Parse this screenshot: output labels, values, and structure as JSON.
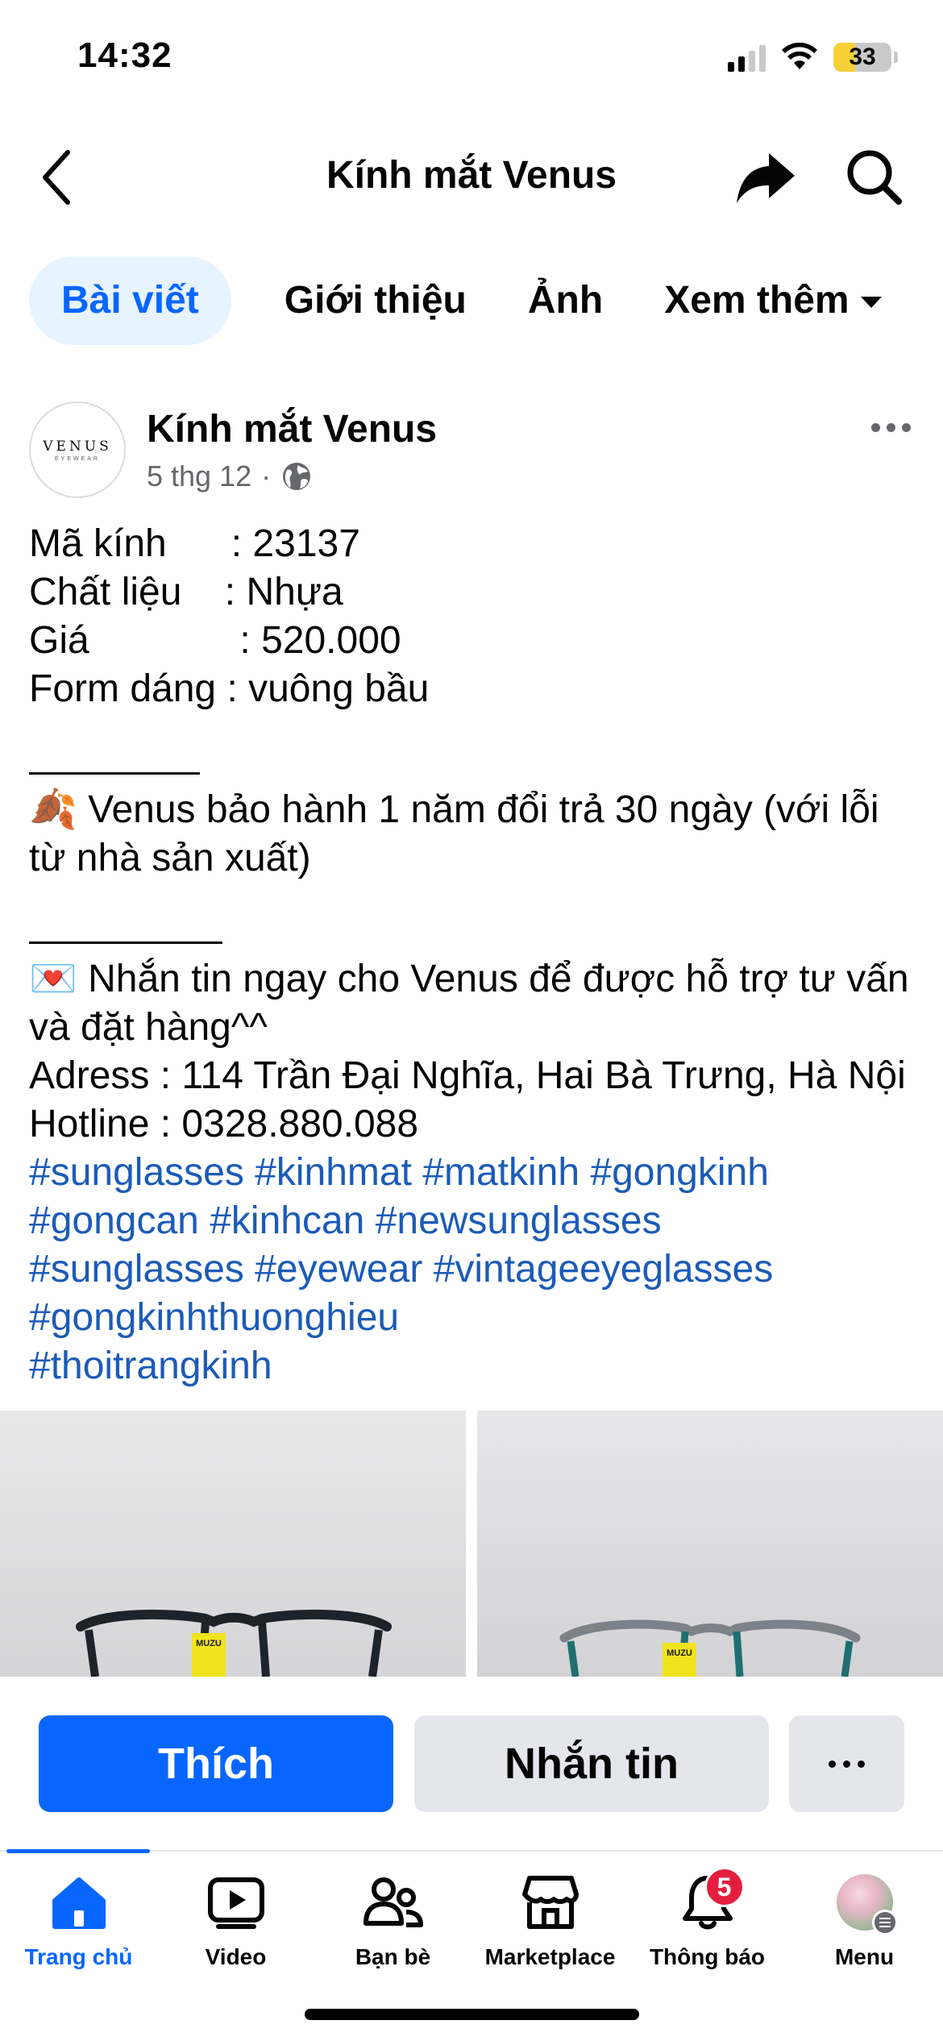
{
  "status_bar": {
    "time": "14:32",
    "battery": "33"
  },
  "header": {
    "title": "Kính mắt Venus"
  },
  "tabs": [
    {
      "label": "Bài viết",
      "active": true
    },
    {
      "label": "Giới thiệu"
    },
    {
      "label": "Ảnh"
    },
    {
      "label": "Xem thêm"
    }
  ],
  "post": {
    "author": "Kính mắt Venus",
    "date": "5 thg 12",
    "separator": "·",
    "avatar_text": {
      "brand": "VENUS",
      "sub": "EYEWEAR"
    },
    "lines": {
      "l1": "Mã kính      : 23137",
      "l2": "Chất liệu    : Nhựa",
      "l3": "Giá              : 520.000",
      "l4": "Form dáng : vuông bầu",
      "warranty": "🍂 Venus  bảo hành 1 năm đổi trả 30 ngày (với lỗi từ nhà sản xuất)",
      "contact": "💌 Nhắn tin ngay cho Venus để được hỗ trợ tư vấn và đặt hàng^^",
      "address": "Adress : 114 Trần Đại Nghĩa, Hai Bà Trưng, Hà Nội",
      "hotline": "Hotline : 0328.880.088"
    },
    "hashtags": {
      "row1": "#sunglasses #kinhmat #matkinh #gongkinh",
      "row2": "#gongcan #kinhcan #newsunglasses",
      "row3": "#sunglasses #eyewear #vintageeyeglasses",
      "row4": "#gongkinhthuonghieu",
      "row5": "#thoitrangkinh"
    },
    "photo_labels": {
      "left": "MUZU",
      "right": "MUZU"
    }
  },
  "actions": {
    "like": "Thích",
    "message": "Nhắn tin"
  },
  "nav": [
    {
      "label": "Trang chủ",
      "icon": "home-icon",
      "active": true
    },
    {
      "label": "Video",
      "icon": "video-icon"
    },
    {
      "label": "Bạn bè",
      "icon": "friends-icon"
    },
    {
      "label": "Marketplace",
      "icon": "marketplace-icon"
    },
    {
      "label": "Thông báo",
      "icon": "bell-icon",
      "badge": "5"
    },
    {
      "label": "Menu",
      "icon": "menu-avatar"
    }
  ],
  "colors": {
    "accent": "#0866ff",
    "hashtag": "#1b5bb8",
    "badge": "#e41e3f",
    "muted": "#65676b"
  }
}
